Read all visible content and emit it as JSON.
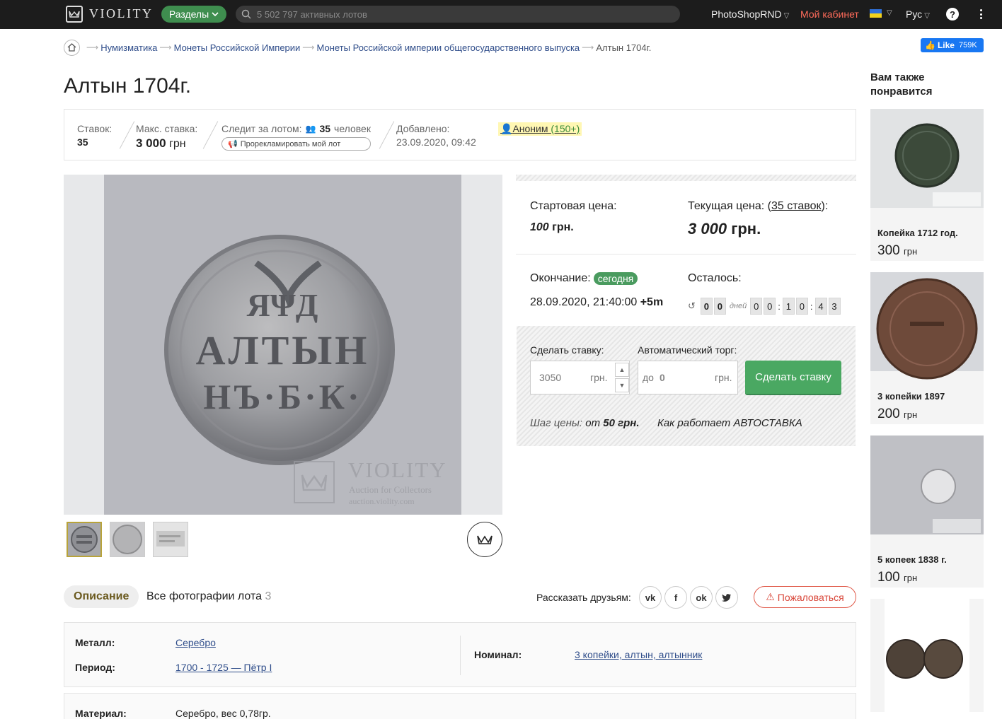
{
  "header": {
    "logo_text": "VIOLITY",
    "sections_label": "Разделы",
    "search_placeholder": "5 502 797 активных лотов",
    "username": "PhotoShopRND",
    "cabinet_label": "Мой кабинет",
    "lang_label": "Рус",
    "icons": [
      "crown-logo-icon",
      "search-icon",
      "ukraine-flag-icon",
      "help-icon",
      "more-vertical-icon"
    ]
  },
  "breadcrumb": {
    "items": [
      "Нумизматика",
      "Монеты Российской Империи",
      "Монеты Российской империи общегосударственного выпуска"
    ],
    "current": "Алтын 1704г."
  },
  "fb": {
    "label": "Like",
    "count": "759K"
  },
  "lot": {
    "title": "Алтын 1704г.",
    "bids_label": "Ставок:",
    "bids_value": "35",
    "max_bid_label": "Макс. ставка:",
    "max_bid_value": "3 000",
    "max_bid_currency": "грн",
    "watchers_label": "Следит за лотом:",
    "watchers_count": "35",
    "watchers_unit": "человек",
    "promote_label": "Прорекламировать мой лот",
    "added_label": "Добавлено:",
    "added_value": "23.09.2020, 09:42",
    "seller": "Аноним",
    "seller_rating": "(150+)"
  },
  "gallery": {
    "watermark_title": "VIOLITY",
    "watermark_sub1": "Auction for Collectors",
    "watermark_sub2": "auction.violity.com",
    "coin_lines": [
      "АЛТЫН",
      "НЪ·Б·К·"
    ]
  },
  "pricing": {
    "start_label": "Стартовая цена:",
    "start_value": "100",
    "start_currency": "грн.",
    "current_label": "Текущая цена: (",
    "current_bids": "35 ставок",
    "current_close": "):",
    "current_value": "3 000",
    "current_currency": "грн.",
    "end_label": "Окончание:",
    "end_badge": "сегодня",
    "end_datetime": "28.09.2020, 21:40:00",
    "end_tz": "+5m",
    "remaining_label": "Осталось:",
    "days_digits": [
      "0",
      "0"
    ],
    "days_label": "дней",
    "time_digits": [
      "0",
      "0",
      "1",
      "0",
      "4",
      "3"
    ]
  },
  "bid": {
    "make_bid_label": "Сделать ставку:",
    "bid_value": "3050",
    "bid_currency": "грн.",
    "auto_label": "Автоматический торг:",
    "auto_prefix": "до",
    "auto_value": "0",
    "auto_currency": "грн.",
    "button_label": "Сделать ставку",
    "step_label": "Шаг цены:",
    "step_from": "от",
    "step_value": "50 грн.",
    "how_auto_label": "Как работает АВТОСТАВКА"
  },
  "tabs": {
    "description": "Описание",
    "all_photos": "Все фотографии лота",
    "all_photos_count": "3",
    "share_label": "Рассказать друзьям:",
    "social": [
      "vk",
      "facebook",
      "odnoklassniki",
      "twitter"
    ],
    "report_label": "Пожаловаться"
  },
  "props": {
    "metal_label": "Металл:",
    "metal_value": "Серебро",
    "period_label": "Период:",
    "period_value": "1700 - 1725 — Пётр I",
    "nominal_label": "Номинал:",
    "nominal_value": "3 копейки, алтын, алтынник",
    "material_label": "Материал:",
    "material_value": "Серебро, вес 0,78гр."
  },
  "sidebar": {
    "title": "Вам также понравится",
    "items": [
      {
        "name": "Копейка 1712 год.",
        "price": "300",
        "currency": "грн"
      },
      {
        "name": "3 копейки 1897",
        "price": "200",
        "currency": "грн"
      },
      {
        "name": "5 копеек 1838 г.",
        "price": "100",
        "currency": "грн"
      }
    ]
  }
}
